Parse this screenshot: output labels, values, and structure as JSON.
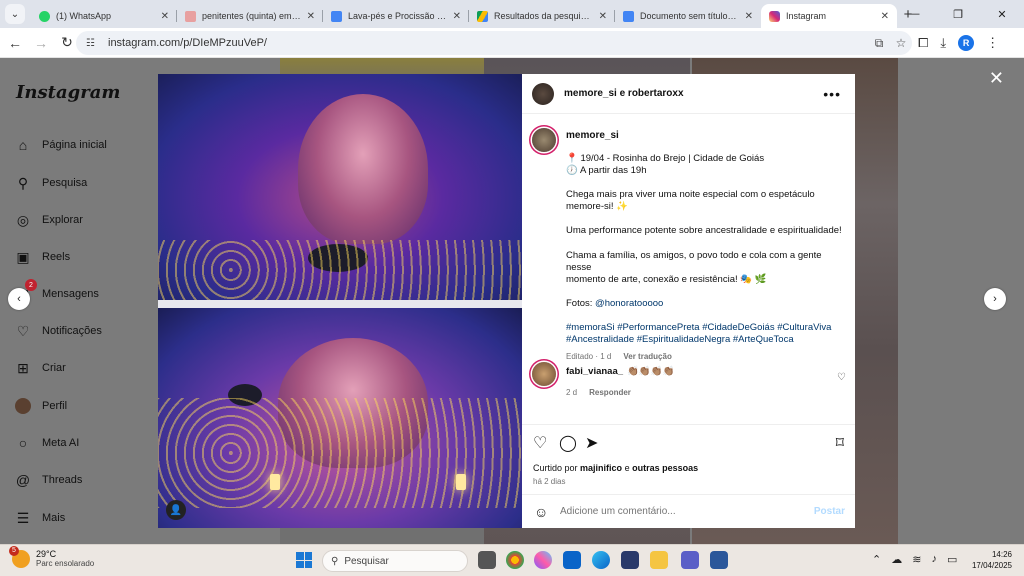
{
  "browser": {
    "tabs": [
      {
        "title": "(1) WhatsApp",
        "favicon_color": "#25d366"
      },
      {
        "title": "penitentes (quinta) em JOÃ",
        "favicon_color": "#e8a0a0"
      },
      {
        "title": "Lava-pés e Procissão dos P",
        "favicon_color": "#4285f4"
      },
      {
        "title": "Resultados da pesquisa - G",
        "favicon_color": "#fbbc04"
      },
      {
        "title": "Documento sem título - Do",
        "favicon_color": "#4285f4"
      },
      {
        "title": "Instagram",
        "favicon_color": "#d6249f",
        "active": true
      }
    ],
    "url": "instagram.com/p/DIeMPzuuVeP/",
    "profile_initial": "R"
  },
  "sidebar": {
    "logo": "Instagram",
    "items": [
      {
        "label": "Página inicial",
        "icon": "home-icon"
      },
      {
        "label": "Pesquisa",
        "icon": "search-icon"
      },
      {
        "label": "Explorar",
        "icon": "compass-icon"
      },
      {
        "label": "Reels",
        "icon": "reels-icon"
      },
      {
        "label": "Mensagens",
        "icon": "messenger-icon",
        "badge": "2"
      },
      {
        "label": "Notificações",
        "icon": "heart-icon"
      },
      {
        "label": "Criar",
        "icon": "plus-square-icon"
      },
      {
        "label": "Perfil",
        "icon": "avatar"
      },
      {
        "label": "Meta AI",
        "icon": "meta-ai-icon"
      },
      {
        "label": "Threads",
        "icon": "threads-icon"
      },
      {
        "label": "Mais",
        "icon": "menu-icon"
      }
    ]
  },
  "post": {
    "header_users": "memore_si e robertaroxx",
    "author": "memore_si",
    "caption_lines": [
      "📍 19/04 - Rosinha do Brejo | Cidade de Goiás",
      "🕖 A partir das 19h",
      "",
      "Chega mais pra viver uma noite especial com o espetáculo",
      "memore-si! ✨",
      "",
      "Uma performance potente sobre ancestralidade e espiritualidade!",
      "",
      "Chama a família, os amigos, o povo todo e cola com a gente nesse",
      "momento de arte, conexão e resistência! 🎭 🌿",
      ""
    ],
    "photos_credit_label": "Fotos:",
    "photos_credit_handle": "@honoratooooo",
    "hashtags_line1": "#memoraSi #PerformancePreta #CidadeDeGoiás #CulturaViva",
    "hashtags_line2": "#Ancestralidade #EspiritualidadeNegra #ArteQueToca",
    "edited": "Editado · 1 d",
    "see_translation": "Ver tradução",
    "comment": {
      "user": "fabi_vianaa_",
      "text": "👏🏽👏🏽👏🏽👏🏽",
      "time": "2 d",
      "reply": "Responder"
    },
    "liked_by_prefix": "Curtido por",
    "liked_by_user": "majinifico",
    "liked_by_and": "e",
    "liked_by_others": "outras pessoas",
    "time_ago": "há 2 dias",
    "comment_placeholder": "Adicione um comentário...",
    "post_button": "Postar"
  },
  "taskbar": {
    "temperature": "29°C",
    "weather_desc": "Parc ensolarado",
    "weather_badge": "5",
    "search_label": "Pesquisar",
    "time": "14:26",
    "date": "17/04/2025"
  }
}
